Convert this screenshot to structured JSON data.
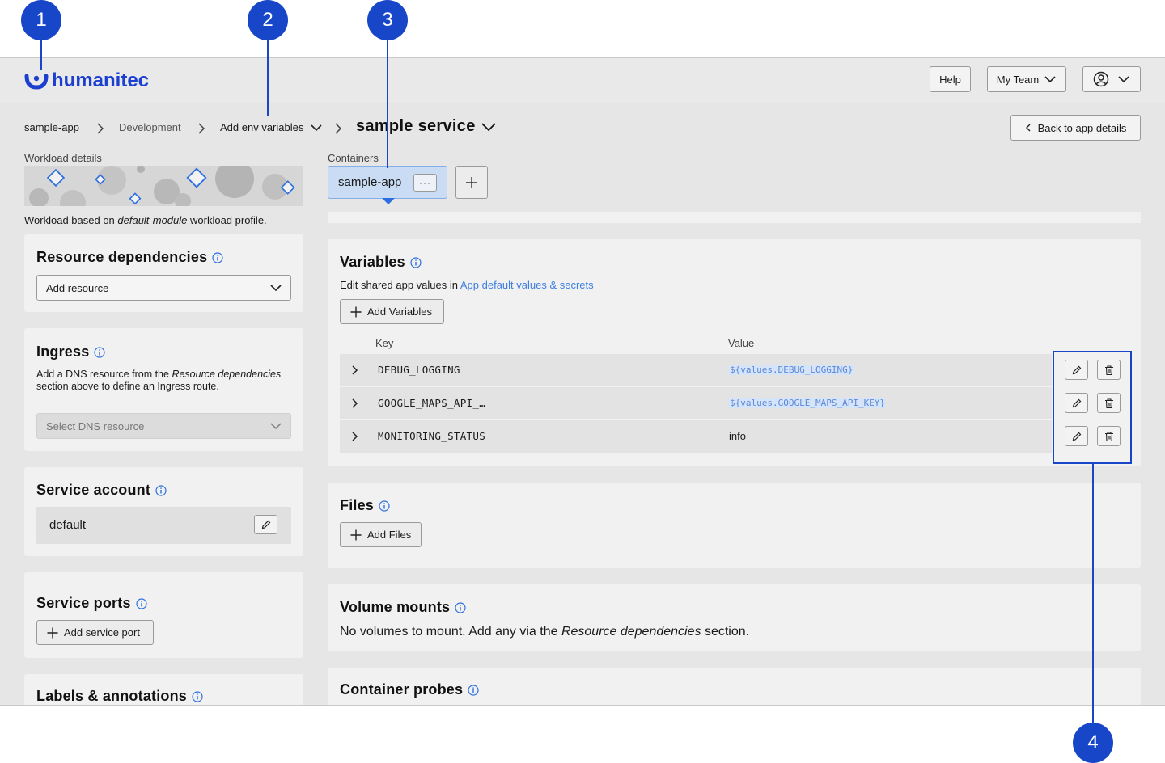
{
  "callouts": [
    "1",
    "2",
    "3",
    "4"
  ],
  "header": {
    "logo_text": "humanitec",
    "help_label": "Help",
    "team_label": "My Team"
  },
  "breadcrumb": {
    "app": "sample-app",
    "env": "Development",
    "deployment": "Add env variables",
    "service": "sample service"
  },
  "back_button": "Back to app details",
  "workload": {
    "section_label": "Workload details",
    "note_prefix": "Workload based on ",
    "note_module": "default-module",
    "note_suffix": " workload profile."
  },
  "resource_dependencies": {
    "title": "Resource dependencies",
    "select_value": "Add resource"
  },
  "ingress": {
    "title": "Ingress",
    "desc_1": "Add a DNS resource from the ",
    "desc_em": "Resource dependencies",
    "desc_2": " section above to define an Ingress route.",
    "select_placeholder": "Select DNS resource"
  },
  "service_account": {
    "title": "Service account",
    "value": "default"
  },
  "service_ports": {
    "title": "Service ports",
    "button": "Add service port"
  },
  "labels": {
    "title": "Labels & annotations"
  },
  "containers": {
    "section_label": "Containers",
    "active": "sample-app",
    "more": "···"
  },
  "variables": {
    "title": "Variables",
    "edit_prefix": "Edit shared app values in ",
    "edit_link": "App default values & secrets",
    "add_button": "Add Variables",
    "col_key": "Key",
    "col_value": "Value",
    "rows": [
      {
        "key": "DEBUG_LOGGING",
        "value": "${values.DEBUG_LOGGING}",
        "is_ref": true
      },
      {
        "key": "GOOGLE_MAPS_API_…",
        "value": "${values.GOOGLE_MAPS_API_KEY}",
        "is_ref": true
      },
      {
        "key": "MONITORING_STATUS",
        "value": "info",
        "is_ref": false
      }
    ]
  },
  "files": {
    "title": "Files",
    "add_button": "Add Files"
  },
  "volume_mounts": {
    "title": "Volume mounts",
    "desc_prefix": "No volumes to mount. Add any via the ",
    "desc_em": "Resource dependencies",
    "desc_suffix": " section."
  },
  "container_probes": {
    "title": "Container probes"
  },
  "colors": {
    "accent": "#1746c9",
    "link": "#3d7fe0",
    "selected_tab": "#c9dcf4"
  }
}
